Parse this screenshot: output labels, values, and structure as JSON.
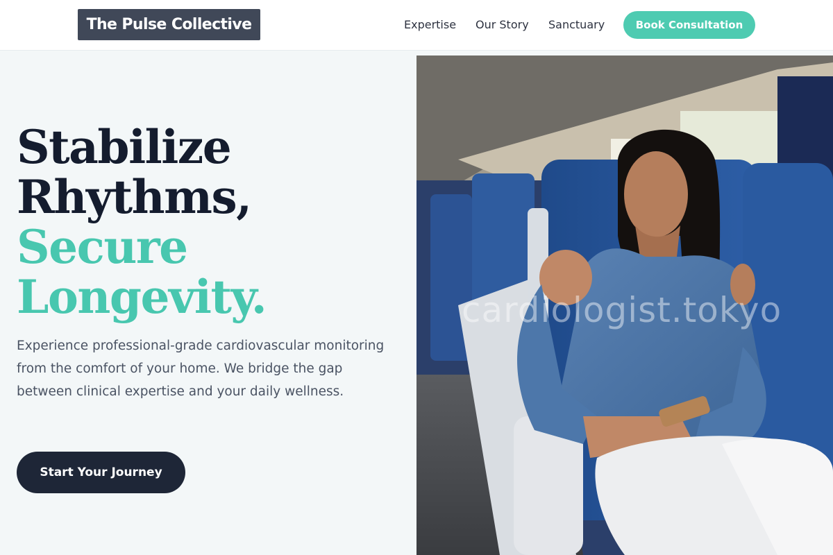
{
  "header": {
    "logo_text": "The Pulse Collective",
    "nav": [
      {
        "label": "Expertise"
      },
      {
        "label": "Our Story"
      },
      {
        "label": "Sanctuary"
      }
    ],
    "cta_label": "Book Consultation"
  },
  "hero": {
    "headline_line1": "Stabilize",
    "headline_line2": "Rhythms,",
    "headline_line3": "Secure",
    "headline_line4": "Longevity.",
    "lead": "Experience professional-grade cardiovascular monitoring from the comfort of your home. We bridge the gap between clinical expertise and your daily wellness.",
    "cta_label": "Start Your Journey",
    "image_watermark": "cardiologist.tokyo"
  },
  "colors": {
    "accent": "#4ecbb1",
    "dark": "#141c2e",
    "logo_bg": "#404858",
    "button_dark": "#1e2637",
    "page_bg": "#f3f7f8"
  }
}
